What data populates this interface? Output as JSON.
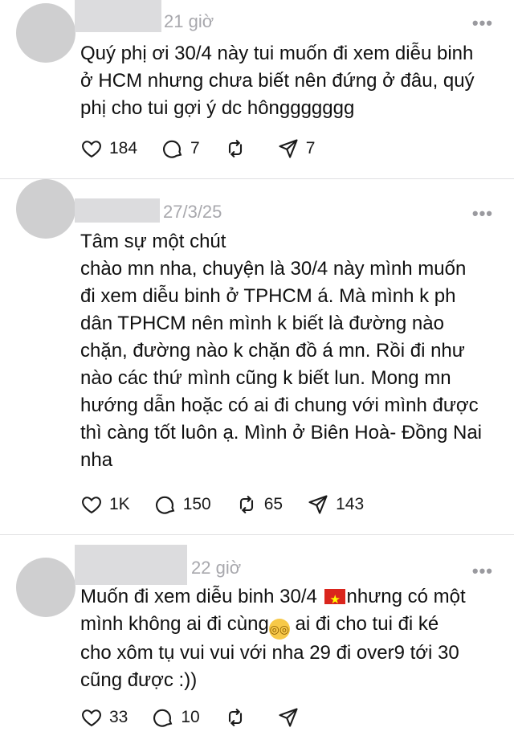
{
  "posts": [
    {
      "time": "21 giờ",
      "lines": [
        "Quý phị ơi 30/4 này tui muốn đi xem diễu binh",
        "ở HCM nhưng chưa biết nên đứng ở đâu, quý",
        "phị cho tui gợi ý dc hônggggggg"
      ],
      "likes": "184",
      "replies": "7",
      "reposts": "",
      "shares": "7"
    },
    {
      "time": "27/3/25",
      "subtitle": "Tâm sự một chút",
      "lines": [
        "chào mn nha, chuyện là 30/4 này mình muốn",
        "đi xem diễu binh ở TPHCM á. Mà mình k ph",
        "dân TPHCM nên mình k biết là đường nào",
        "chặn, đường nào k chặn đồ á mn. Rồi đi như",
        "nào các thứ mình cũng k biết lun. Mong mn",
        "hướng dẫn hoặc có ai đi chung với mình được",
        "thì càng tốt luôn ạ. Mình ở Biên Hoà- Đồng Nai",
        "nha"
      ],
      "likes": "1K",
      "replies": "150",
      "reposts": "65",
      "shares": "143"
    },
    {
      "time": "22 giờ",
      "line1_a": "Muốn đi xem diễu binh 30/4 ",
      "line1_b": "nhưng có một",
      "line2_a": "mình không ai đi cùng",
      "line2_b": " ai đi cho tui đi ké",
      "line3": "cho xôm tụ vui vui với nha 29 đi over9 tới 30",
      "line4": "cũng được :))",
      "likes": "33",
      "replies": "10",
      "reposts": "",
      "shares": ""
    }
  ],
  "more_glyph": "•••",
  "icons": [
    "heart-icon",
    "comment-icon",
    "repost-icon",
    "share-icon"
  ]
}
